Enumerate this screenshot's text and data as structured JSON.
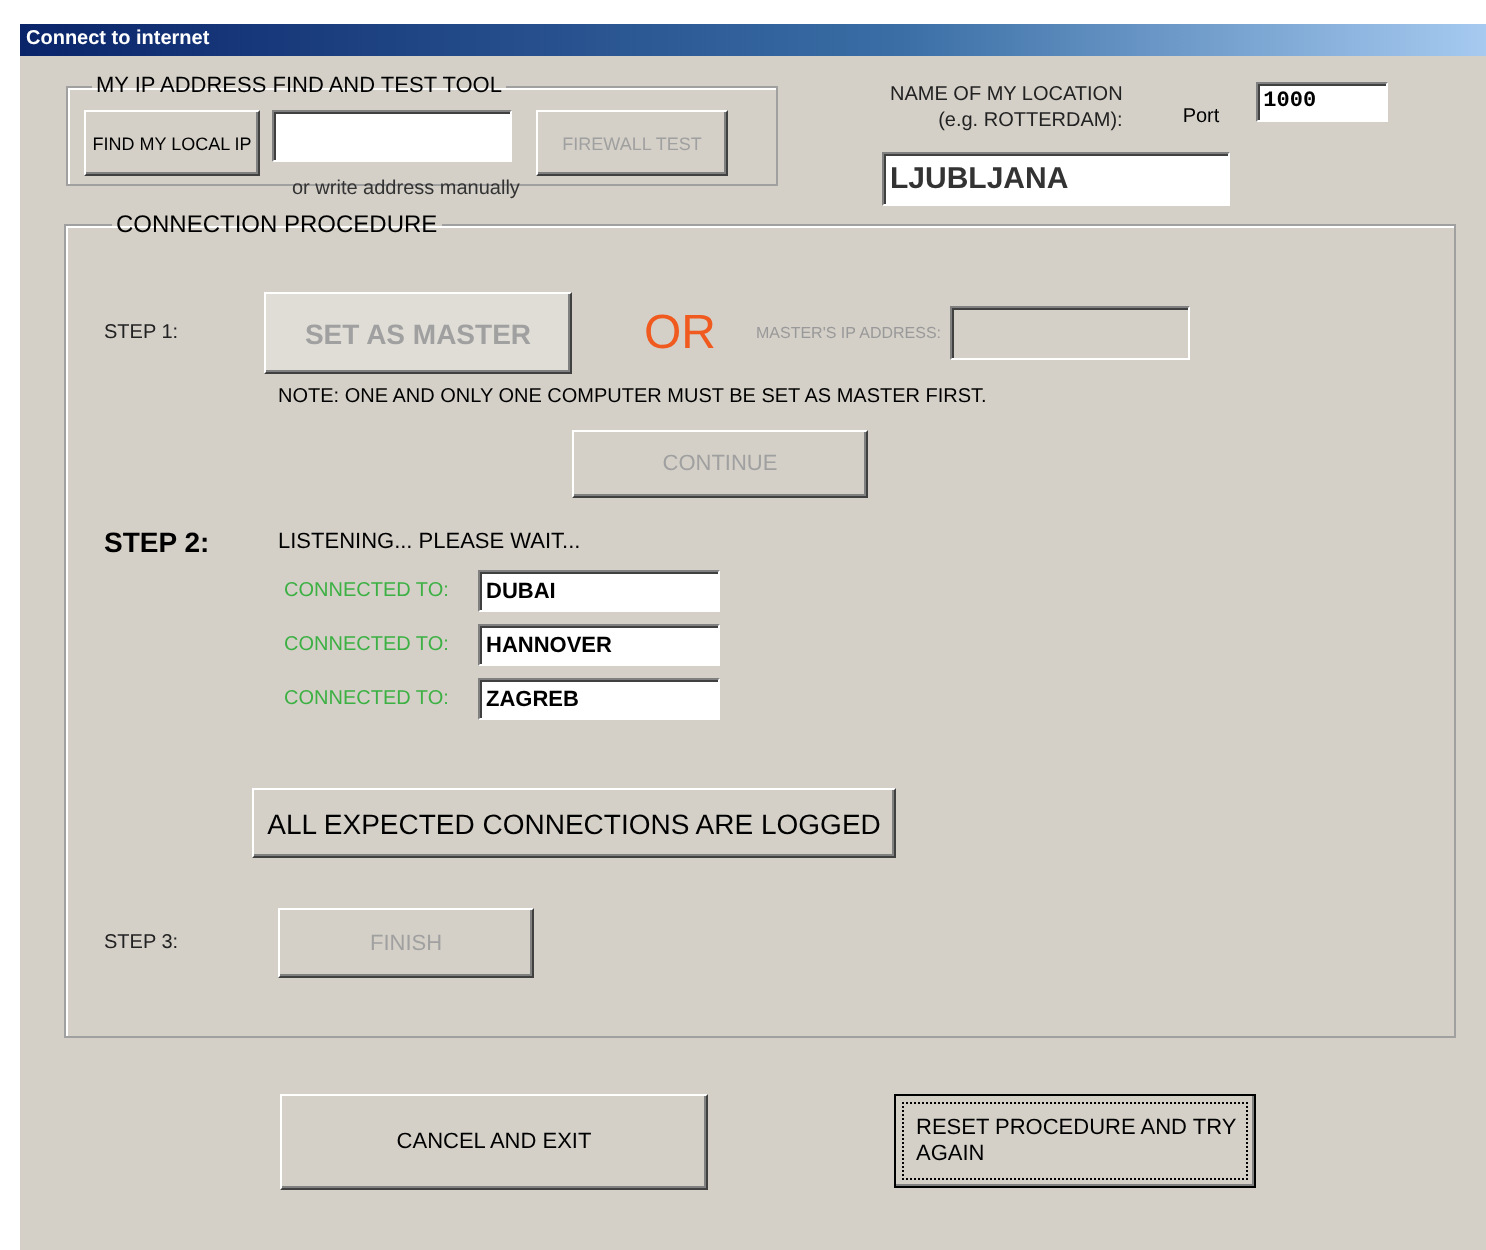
{
  "window": {
    "title": "Connect to internet"
  },
  "ip_tool": {
    "title": "MY IP ADDRESS FIND AND TEST TOOL",
    "find_button": {
      "label": "FIND MY LOCAL IP",
      "disabled": false
    },
    "hint": "or write address manually",
    "firewall_button": {
      "label": "FIREWALL TEST",
      "disabled": true
    }
  },
  "location": {
    "label_lines": [
      "NAME OF MY LOCATION",
      "(e.g. ROTTERDAM):"
    ],
    "value": "LJUBLJANA"
  },
  "port": {
    "label": "Port",
    "value": "1000"
  },
  "procedure": {
    "title": "CONNECTION PROCEDURE",
    "step1": {
      "label": "STEP 1:",
      "active": false,
      "master_button": {
        "label": "SET AS MASTER",
        "disabled": true
      },
      "or": "OR",
      "master_ip": {
        "label": "MASTER'S IP ADDRESS:",
        "disabled": true
      },
      "note": "NOTE: ONE AND ONLY ONE COMPUTER MUST BE SET AS MASTER FIRST.",
      "continue_button": {
        "label": "CONTINUE",
        "disabled": true
      }
    },
    "step2": {
      "label": "STEP 2:",
      "active": true,
      "status": "LISTENING... PLEASE WAIT...",
      "connections": [
        {
          "label": "CONNECTED TO:",
          "value": "DUBAI"
        },
        {
          "label": "CONNECTED TO:",
          "value": "HANNOVER"
        },
        {
          "label": "CONNECTED TO:",
          "value": "ZAGREB"
        }
      ],
      "logged_button": {
        "label": "ALL EXPECTED CONNECTIONS ARE LOGGED",
        "disabled": false
      }
    },
    "step3": {
      "label": "STEP 3:",
      "active": false,
      "finish_button": {
        "label": "FINISH",
        "disabled": true
      }
    }
  },
  "buttons": [
    {
      "label": "CANCEL AND EXIT",
      "focused": false
    },
    {
      "label": "RESET PROCEDURE AND TRY AGAIN",
      "focused": true
    }
  ]
}
